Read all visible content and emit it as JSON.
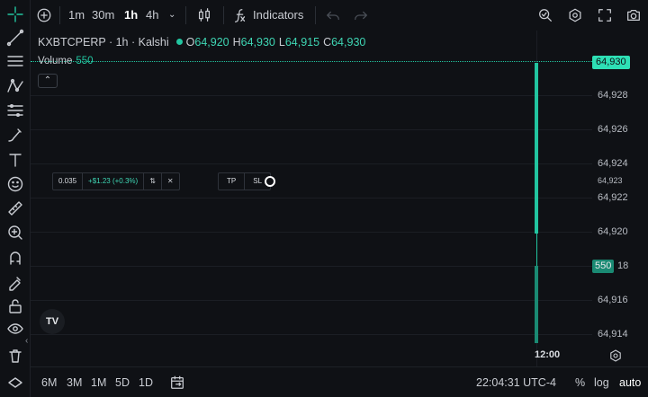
{
  "toolbar": {
    "intervals": [
      "1m",
      "30m",
      "1h",
      "4h"
    ],
    "active_interval": "1h",
    "indicators_label": "Indicators"
  },
  "symbol": {
    "name": "KXBTCPERP · 1h · Kalshi",
    "open_label": "O",
    "open": "64,920",
    "high_label": "H",
    "high": "64,930",
    "low_label": "L",
    "low": "64,915",
    "close_label": "C",
    "close": "64,930"
  },
  "volume": {
    "label": "Volume",
    "value": "550"
  },
  "order": {
    "qty": "0.035",
    "pnl": "+$1.23 (+0.3%)",
    "swap_icon": "⇅",
    "close_icon": "✕"
  },
  "tpsl": {
    "tp": "TP",
    "sl": "SL"
  },
  "price_scale": {
    "labels": [
      "64,928",
      "64,926",
      "64,924",
      "64,923",
      "64,922",
      "64,920",
      "18",
      "64,916",
      "64,914"
    ],
    "current_price": "64,930",
    "volume_tag": "550"
  },
  "time_axis": {
    "label": "12:00"
  },
  "bottom": {
    "ranges": [
      "6M",
      "3M",
      "1M",
      "5D",
      "1D"
    ],
    "clock": "22:04:31 UTC-4",
    "percent": "%",
    "log": "log",
    "auto": "auto"
  },
  "logo_text": "TV",
  "colors": {
    "up": "#22c5a0",
    "background": "#0f1115",
    "volume": "#1a8a73"
  }
}
